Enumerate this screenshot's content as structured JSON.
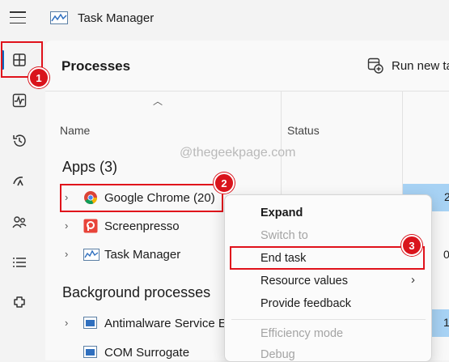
{
  "window": {
    "title": "Task Manager"
  },
  "header": {
    "page_title": "Processes",
    "run_task_label": "Run new ta"
  },
  "columns": {
    "name": "Name",
    "status": "Status",
    "cpu_partial": "2",
    "mem_partial": "0"
  },
  "watermark": "@thegeekpage.com",
  "apps": {
    "group_label": "Apps (3)",
    "items": [
      {
        "name": "Google Chrome (20)",
        "icon": "chrome-icon",
        "cell_value": "2"
      },
      {
        "name": "Screenpresso",
        "icon": "screenpresso-icon",
        "cell_value": ""
      },
      {
        "name": "Task Manager",
        "icon": "task-manager-icon",
        "cell_value": "0"
      }
    ]
  },
  "background": {
    "group_label": "Background processes",
    "items": [
      {
        "name": "Antimalware Service E",
        "icon": "service-icon",
        "cell_value": "1"
      },
      {
        "name": "COM Surrogate",
        "icon": "service-icon",
        "cell_value": ""
      }
    ]
  },
  "context_menu": {
    "expand": "Expand",
    "switch_to": "Switch to",
    "end_task": "End task",
    "resource_values": "Resource values",
    "provide_feedback": "Provide feedback",
    "efficiency_mode": "Efficiency mode",
    "debug": "Debug"
  },
  "annotations": {
    "step1": "1",
    "step2": "2",
    "step3": "3"
  },
  "colors": {
    "annotation_red": "#e0121b",
    "accent": "#0067c0",
    "highlight": "#a7d2f4"
  }
}
